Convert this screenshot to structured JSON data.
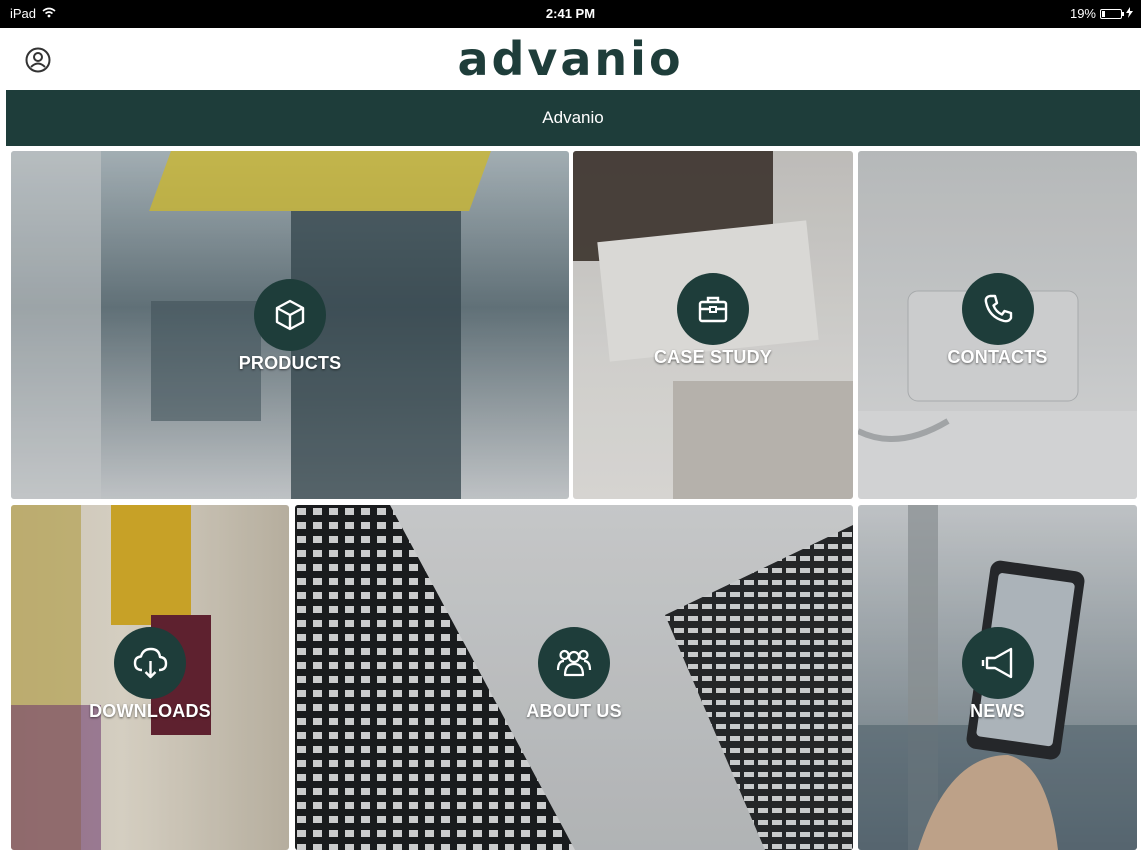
{
  "status_bar": {
    "device": "iPad",
    "time": "2:41 PM",
    "battery_percent": "19%",
    "battery_level": 0.19
  },
  "header": {
    "logo_text": "advanio",
    "title": "Advanio",
    "user_icon": "user-circle-icon"
  },
  "tiles": {
    "products": {
      "label": "PRODUCTS",
      "icon": "cube-icon"
    },
    "case_study": {
      "label": "CASE STUDY",
      "icon": "briefcase-icon"
    },
    "contacts": {
      "label": "CONTACTS",
      "icon": "phone-icon"
    },
    "downloads": {
      "label": "DOWNLOADS",
      "icon": "cloud-download-icon"
    },
    "about_us": {
      "label": "ABOUT US",
      "icon": "group-icon"
    },
    "news": {
      "label": "NEWS",
      "icon": "megaphone-icon"
    }
  },
  "colors": {
    "brand": "#1e3d3a",
    "statusbar": "#000000",
    "tile_text": "#ffffff"
  }
}
